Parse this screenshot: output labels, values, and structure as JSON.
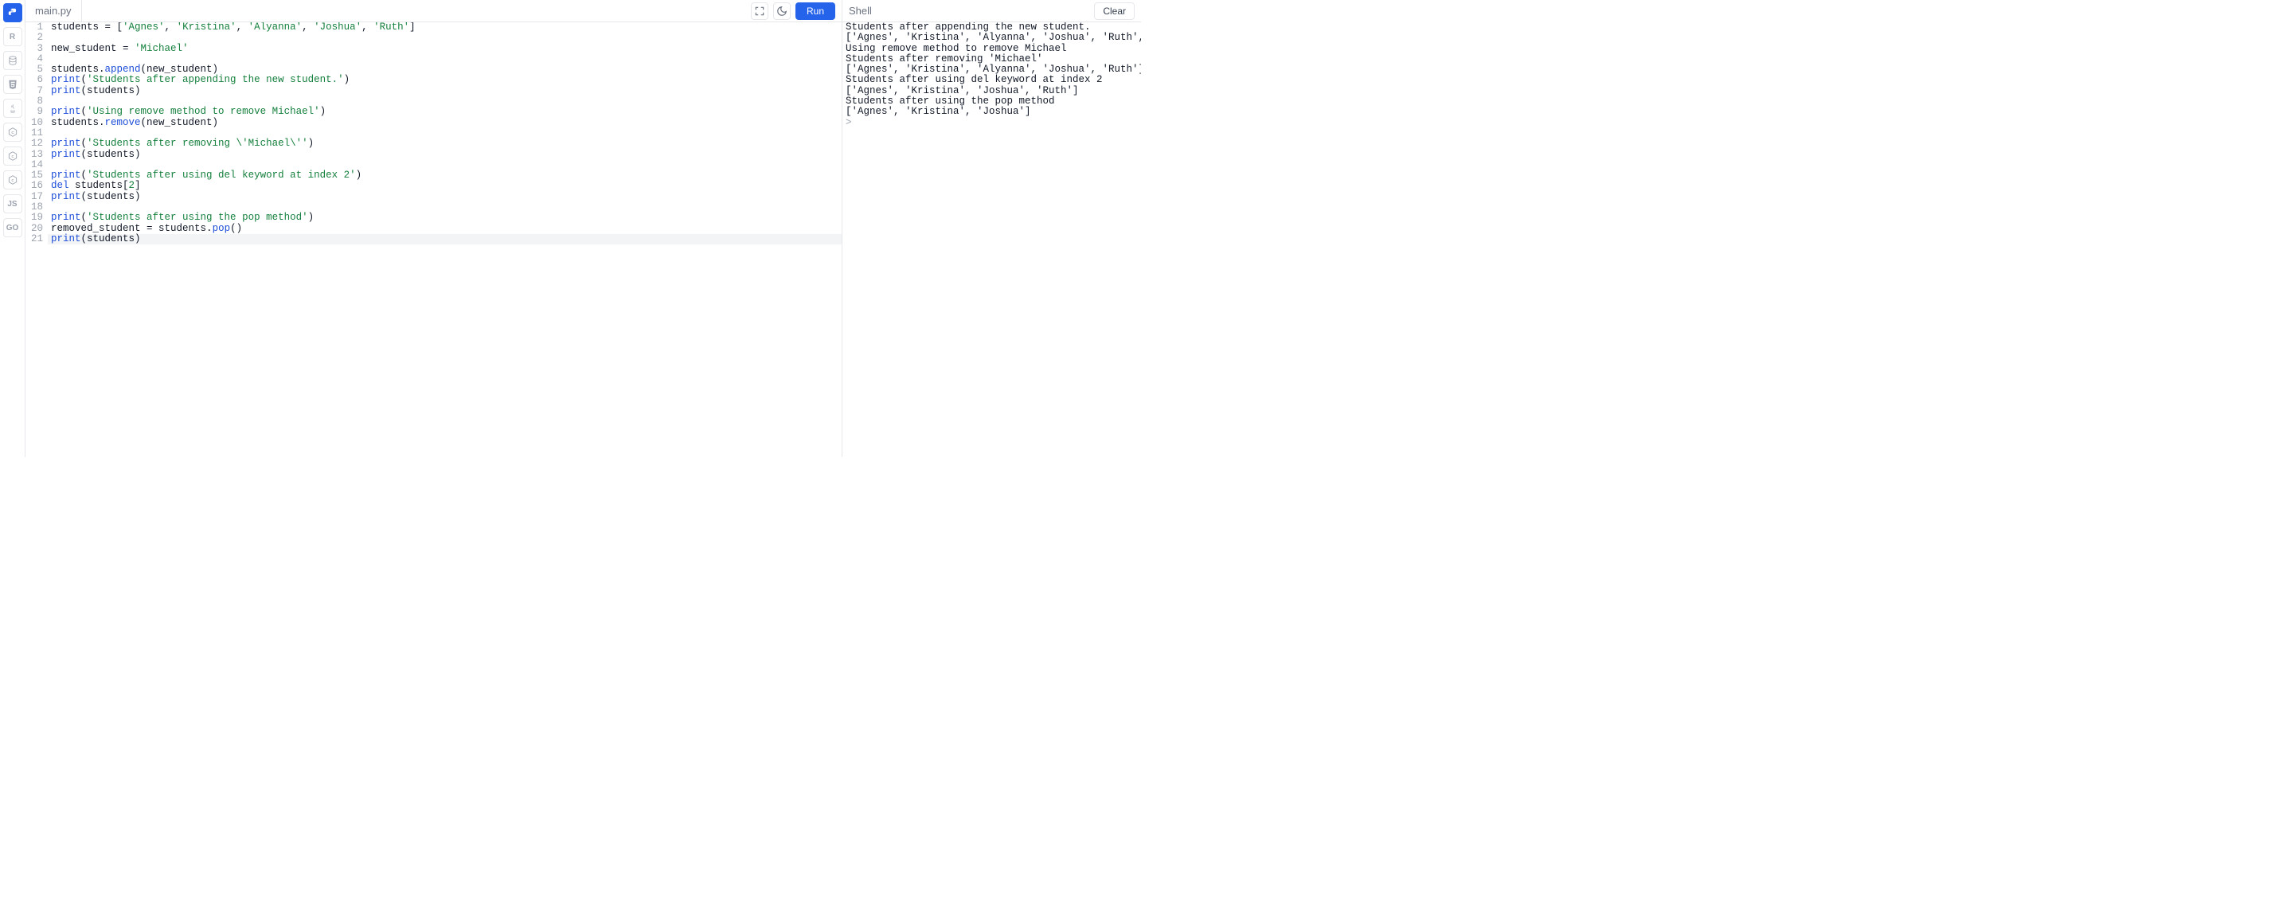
{
  "sidebar": {
    "langs": [
      "Py",
      "R",
      "DB",
      "5",
      "J",
      "C",
      "C",
      "C",
      "JS",
      "GO"
    ]
  },
  "tab": {
    "filename": "main.py"
  },
  "toolbar": {
    "run_label": "Run"
  },
  "shell": {
    "label": "Shell",
    "clear_label": "Clear"
  },
  "code": {
    "lines": [
      [
        [
          "id",
          "students "
        ],
        [
          "op",
          "= ["
        ],
        [
          "str",
          "'Agnes'"
        ],
        [
          "op",
          ", "
        ],
        [
          "str",
          "'Kristina'"
        ],
        [
          "op",
          ", "
        ],
        [
          "str",
          "'Alyanna'"
        ],
        [
          "op",
          ", "
        ],
        [
          "str",
          "'Joshua'"
        ],
        [
          "op",
          ", "
        ],
        [
          "str",
          "'Ruth'"
        ],
        [
          "op",
          "]"
        ]
      ],
      [],
      [
        [
          "id",
          "new_student "
        ],
        [
          "op",
          "= "
        ],
        [
          "str",
          "'Michael'"
        ]
      ],
      [],
      [
        [
          "id",
          "students."
        ],
        [
          "builtin",
          "append"
        ],
        [
          "op",
          "(new_student)"
        ]
      ],
      [
        [
          "builtin",
          "print"
        ],
        [
          "op",
          "("
        ],
        [
          "str",
          "'Students after appending the new student.'"
        ],
        [
          "op",
          ")"
        ]
      ],
      [
        [
          "builtin",
          "print"
        ],
        [
          "op",
          "(students)"
        ]
      ],
      [],
      [
        [
          "builtin",
          "print"
        ],
        [
          "op",
          "("
        ],
        [
          "str",
          "'Using remove method to remove Michael'"
        ],
        [
          "op",
          ")"
        ]
      ],
      [
        [
          "id",
          "students."
        ],
        [
          "builtin",
          "remove"
        ],
        [
          "op",
          "(new_student)"
        ]
      ],
      [],
      [
        [
          "builtin",
          "print"
        ],
        [
          "op",
          "("
        ],
        [
          "str",
          "'Students after removing \\'Michael\\''"
        ],
        [
          "op",
          ")"
        ]
      ],
      [
        [
          "builtin",
          "print"
        ],
        [
          "op",
          "(students)"
        ]
      ],
      [],
      [
        [
          "builtin",
          "print"
        ],
        [
          "op",
          "("
        ],
        [
          "str",
          "'Students after using del keyword at index 2'"
        ],
        [
          "op",
          ")"
        ]
      ],
      [
        [
          "kw",
          "del"
        ],
        [
          "id",
          " students["
        ],
        [
          "num",
          "2"
        ],
        [
          "op",
          "]"
        ]
      ],
      [
        [
          "builtin",
          "print"
        ],
        [
          "op",
          "(students)"
        ]
      ],
      [],
      [
        [
          "builtin",
          "print"
        ],
        [
          "op",
          "("
        ],
        [
          "str",
          "'Students after using the pop method'"
        ],
        [
          "op",
          ")"
        ]
      ],
      [
        [
          "id",
          "removed_student "
        ],
        [
          "op",
          "= "
        ],
        [
          "id",
          "students."
        ],
        [
          "builtin",
          "pop"
        ],
        [
          "op",
          "()"
        ]
      ],
      [
        [
          "builtin",
          "print"
        ],
        [
          "op",
          "(students)"
        ]
      ]
    ],
    "current_line": 21
  },
  "output": {
    "lines": [
      "Students after appending the new student.",
      "['Agnes', 'Kristina', 'Alyanna', 'Joshua', 'Ruth', 'Michael']",
      "Using remove method to remove Michael",
      "Students after removing 'Michael'",
      "['Agnes', 'Kristina', 'Alyanna', 'Joshua', 'Ruth']",
      "Students after using del keyword at index 2",
      "['Agnes', 'Kristina', 'Joshua', 'Ruth']",
      "Students after using the pop method",
      "['Agnes', 'Kristina', 'Joshua']"
    ],
    "prompt": ">"
  }
}
